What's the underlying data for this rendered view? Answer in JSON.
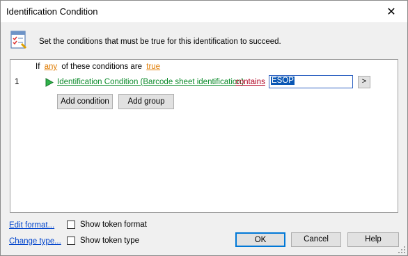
{
  "window": {
    "title": "Identification Condition",
    "close_glyph": "✕"
  },
  "header": {
    "icon": "checklist-icon",
    "instructions": "Set the conditions that must be true for this identification to succeed."
  },
  "conditions": {
    "if_label": "If",
    "quantifier": "any",
    "of_label": "of these conditions are",
    "truth": "true",
    "rows": [
      {
        "number": "1",
        "field": "Identification Condition (Barcode sheet identification)",
        "operator": "contains",
        "value": "ESOP",
        "more_label": ">"
      }
    ],
    "add_condition_label": "Add condition",
    "add_group_label": "Add group"
  },
  "footer": {
    "edit_format_link": "Edit format...",
    "change_type_link": "Change type...",
    "show_token_format_label": "Show token format",
    "show_token_type_label": "Show token type",
    "show_token_format_checked": false,
    "show_token_type_checked": false,
    "ok_label": "OK",
    "cancel_label": "Cancel",
    "help_label": "Help"
  },
  "colors": {
    "orange_link": "#e07b00",
    "green_link": "#0b8a2a",
    "red_link": "#b00020",
    "blue_link": "#0044cc",
    "focus_border": "#0078d7"
  }
}
